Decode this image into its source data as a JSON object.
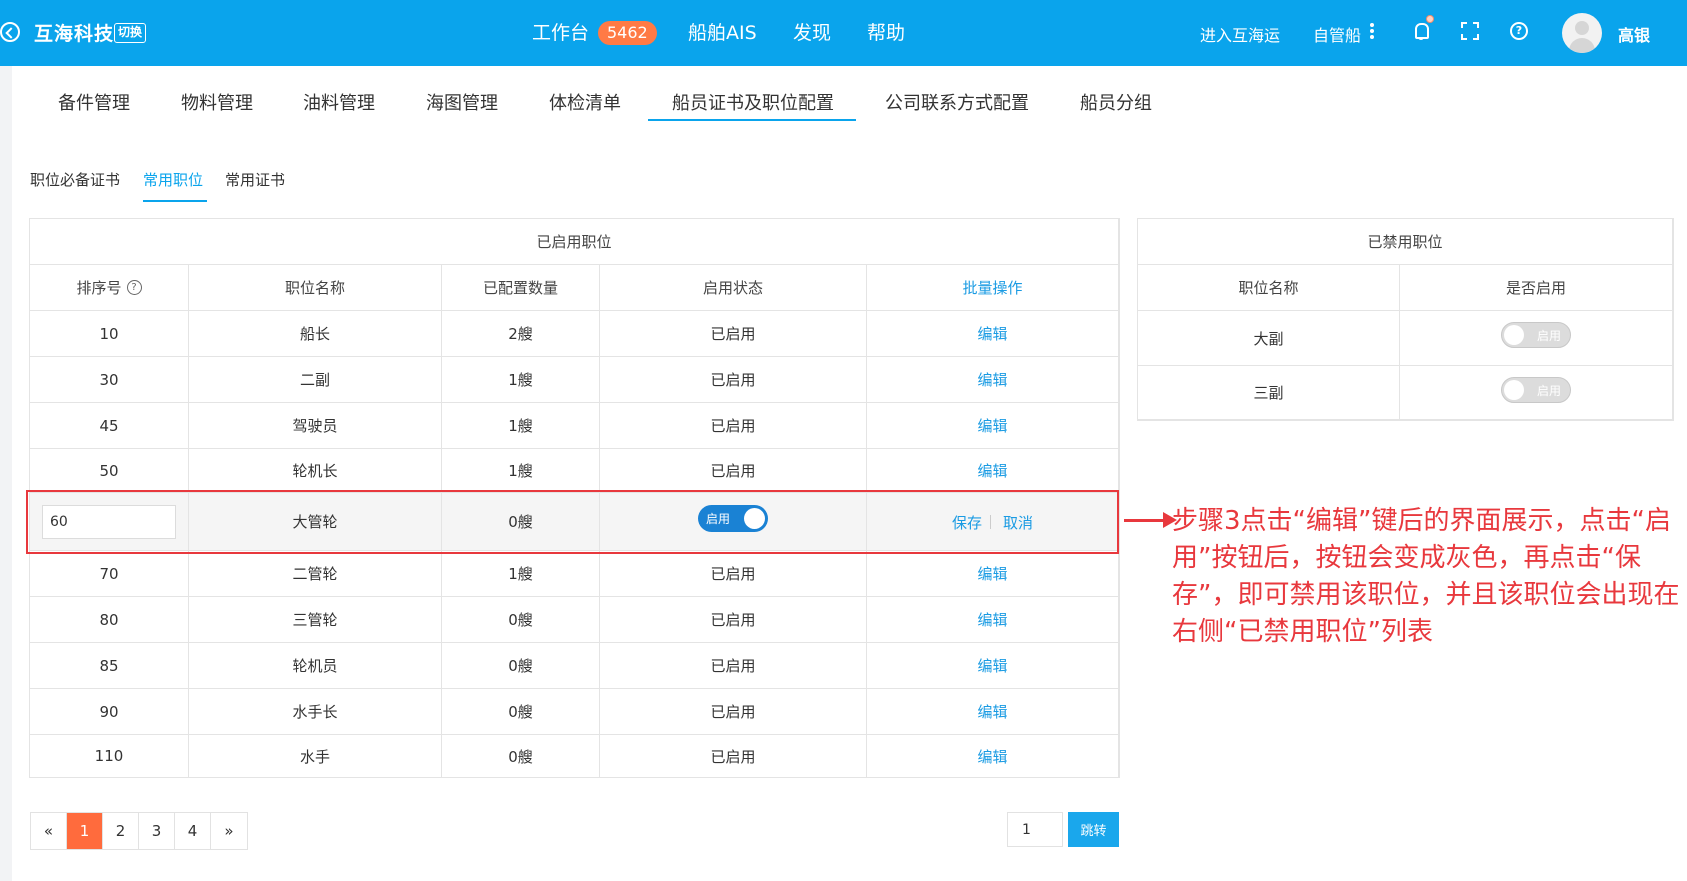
{
  "header": {
    "brand": "互海科技",
    "switch_label": "切换",
    "nav": [
      "工作台",
      "船舶AIS",
      "发现",
      "帮助"
    ],
    "workbench_badge": "5462",
    "enter_link": "进入互海运",
    "own_ship": "自管船",
    "username": "高银"
  },
  "subnav": {
    "items": [
      "备件管理",
      "物料管理",
      "油料管理",
      "海图管理",
      "体检清单",
      "船员证书及职位配置",
      "公司联系方式配置",
      "船员分组"
    ],
    "active_index": 5
  },
  "inner_tabs": {
    "items": [
      "职位必备证书",
      "常用职位",
      "常用证书"
    ],
    "active_index": 1
  },
  "enabled_table": {
    "title": "已启用职位",
    "columns": [
      "排序号",
      "职位名称",
      "已配置数量",
      "启用状态",
      "批量操作"
    ],
    "rows": [
      {
        "seq": "10",
        "name": "船长",
        "count": "2艘",
        "status": "已启用",
        "action": "编辑"
      },
      {
        "seq": "30",
        "name": "二副",
        "count": "1艘",
        "status": "已启用",
        "action": "编辑"
      },
      {
        "seq": "45",
        "name": "驾驶员",
        "count": "1艘",
        "status": "已启用",
        "action": "编辑"
      },
      {
        "seq": "50",
        "name": "轮机长",
        "count": "1艘",
        "status": "已启用",
        "action": "编辑"
      },
      {
        "seq": "60",
        "name": "大管轮",
        "count": "0艘",
        "toggle": "启用",
        "save": "保存",
        "cancel": "取消"
      },
      {
        "seq": "70",
        "name": "二管轮",
        "count": "1艘",
        "status": "已启用",
        "action": "编辑"
      },
      {
        "seq": "80",
        "name": "三管轮",
        "count": "0艘",
        "status": "已启用",
        "action": "编辑"
      },
      {
        "seq": "85",
        "name": "轮机员",
        "count": "0艘",
        "status": "已启用",
        "action": "编辑"
      },
      {
        "seq": "90",
        "name": "水手长",
        "count": "0艘",
        "status": "已启用",
        "action": "编辑"
      },
      {
        "seq": "110",
        "name": "水手",
        "count": "0艘",
        "status": "已启用",
        "action": "编辑"
      }
    ]
  },
  "disabled_table": {
    "title": "已禁用职位",
    "columns": [
      "职位名称",
      "是否启用"
    ],
    "rows": [
      {
        "name": "大副",
        "toggle": "启用"
      },
      {
        "name": "三副",
        "toggle": "启用"
      }
    ]
  },
  "annotation": "步骤3点击“编辑”键后的界面展示，点击“启用”按钮后，按钮会变成灰色，再点击“保存”，即可禁用该职位，并且该职位会出现在右侧“已禁用职位”列表",
  "pagination": {
    "prev": "«",
    "pages": [
      "1",
      "2",
      "3",
      "4"
    ],
    "next": "»",
    "current": "1",
    "jump_value": "1",
    "jump_label": "跳转"
  },
  "colors": {
    "header_bg": "#0aa4ec",
    "accent": "#1a9be3",
    "highlight": "#e8383d",
    "active_page": "#ff6b3d"
  }
}
